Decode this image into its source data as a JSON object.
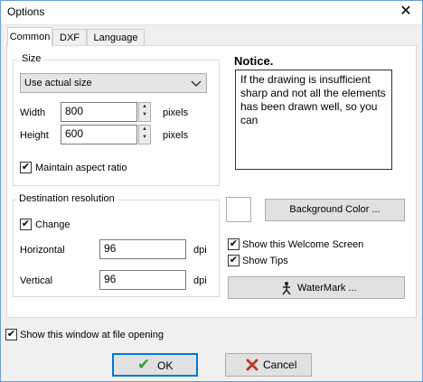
{
  "window": {
    "title": "Options",
    "close_glyph": "✕"
  },
  "tabs": [
    {
      "label": "Common",
      "active": true
    },
    {
      "label": "DXF",
      "active": false
    },
    {
      "label": "Language",
      "active": false
    }
  ],
  "size": {
    "legend": "Size",
    "mode_value": "Use actual size",
    "width_label": "Width",
    "width_value": "800",
    "width_unit": "pixels",
    "height_label": "Height",
    "height_value": "600",
    "height_unit": "pixels",
    "aspect_label": "Maintain aspect ratio",
    "aspect_checked": true
  },
  "notice": {
    "title": "Notice.",
    "text": "If the drawing is insufficient sharp and not all the elements\nhas been drawn well, so you\ncan"
  },
  "resolution": {
    "legend": "Destination resolution",
    "change_label": "Change",
    "change_checked": true,
    "horizontal_label": "Horizontal",
    "horizontal_value": "96",
    "horizontal_unit": "dpi",
    "vertical_label": "Vertical",
    "vertical_value": "96",
    "vertical_unit": "dpi"
  },
  "right": {
    "background_color_button": "Background Color ...",
    "welcome_label": "Show this Welcome Screen",
    "welcome_checked": true,
    "tips_label": "Show Tips",
    "tips_checked": true,
    "watermark_button": "WaterMark ..."
  },
  "footer": {
    "show_window_label": "Show this window at file opening",
    "show_window_checked": true,
    "ok_label": "OK",
    "cancel_label": "Cancel"
  },
  "icons": {
    "checkmark": "✔",
    "ok_icon": "green-checkmark",
    "cancel_icon": "red-x",
    "watermark_icon": "watermark-figure",
    "dropdown_icon": "chevron-down"
  },
  "colors": {
    "ok_check": "#2e9e2e",
    "cancel_x": "#c0392b",
    "focus_border": "#0078d7"
  }
}
